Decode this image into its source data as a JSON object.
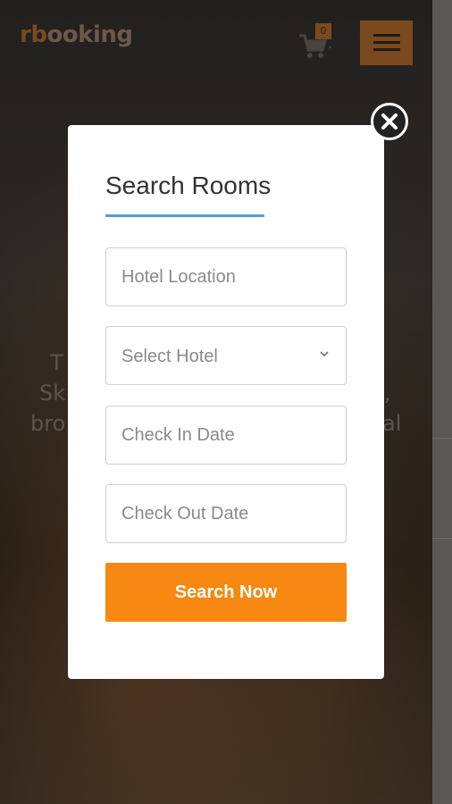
{
  "header": {
    "logo_mark": "rb",
    "logo_text": "ooking",
    "cart_count": "0",
    "menu_icon": "hamburger-icon",
    "cart_icon": "cart-icon"
  },
  "hero": {
    "line1": "T",
    "line2_left": "Sk",
    "line2_right": ",",
    "line3_left": "bro",
    "line3_right": "al"
  },
  "modal": {
    "title": "Search Rooms",
    "location_placeholder": "Hotel Location",
    "hotel_select_value": "Select Hotel",
    "checkin_placeholder": "Check In Date",
    "checkout_placeholder": "Check Out Date",
    "search_button": "Search Now",
    "close_icon": "close-icon"
  },
  "colors": {
    "accent": "#f78812",
    "underline": "#5b9bd5"
  }
}
